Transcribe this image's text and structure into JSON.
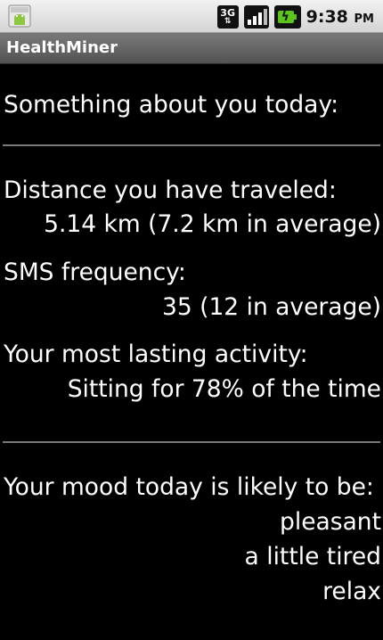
{
  "status_bar": {
    "notification_icon": "android-app-icon",
    "network_label_top": "3G",
    "signal_icon": "signal-bars-icon",
    "battery_icon": "battery-charging-icon",
    "time": "9:38",
    "ampm": "PM"
  },
  "app": {
    "title": "HealthMiner"
  },
  "content": {
    "heading": "Something about you today:",
    "distance_label": "Distance you have traveled:",
    "distance_value": "5.14 km (7.2 km in average)",
    "sms_label": "SMS frequency:",
    "sms_value": "35 (12 in average)",
    "activity_label": "Your most lasting activity:",
    "activity_value": "Sitting for 78% of the time",
    "mood_label": "Your mood today is likely to be:",
    "moods": [
      "pleasant",
      "a little tired",
      "relax"
    ]
  },
  "colors": {
    "background": "#000000",
    "text": "#ffffff",
    "divider": "#7a7a7a",
    "battery": "#5cc21c"
  }
}
